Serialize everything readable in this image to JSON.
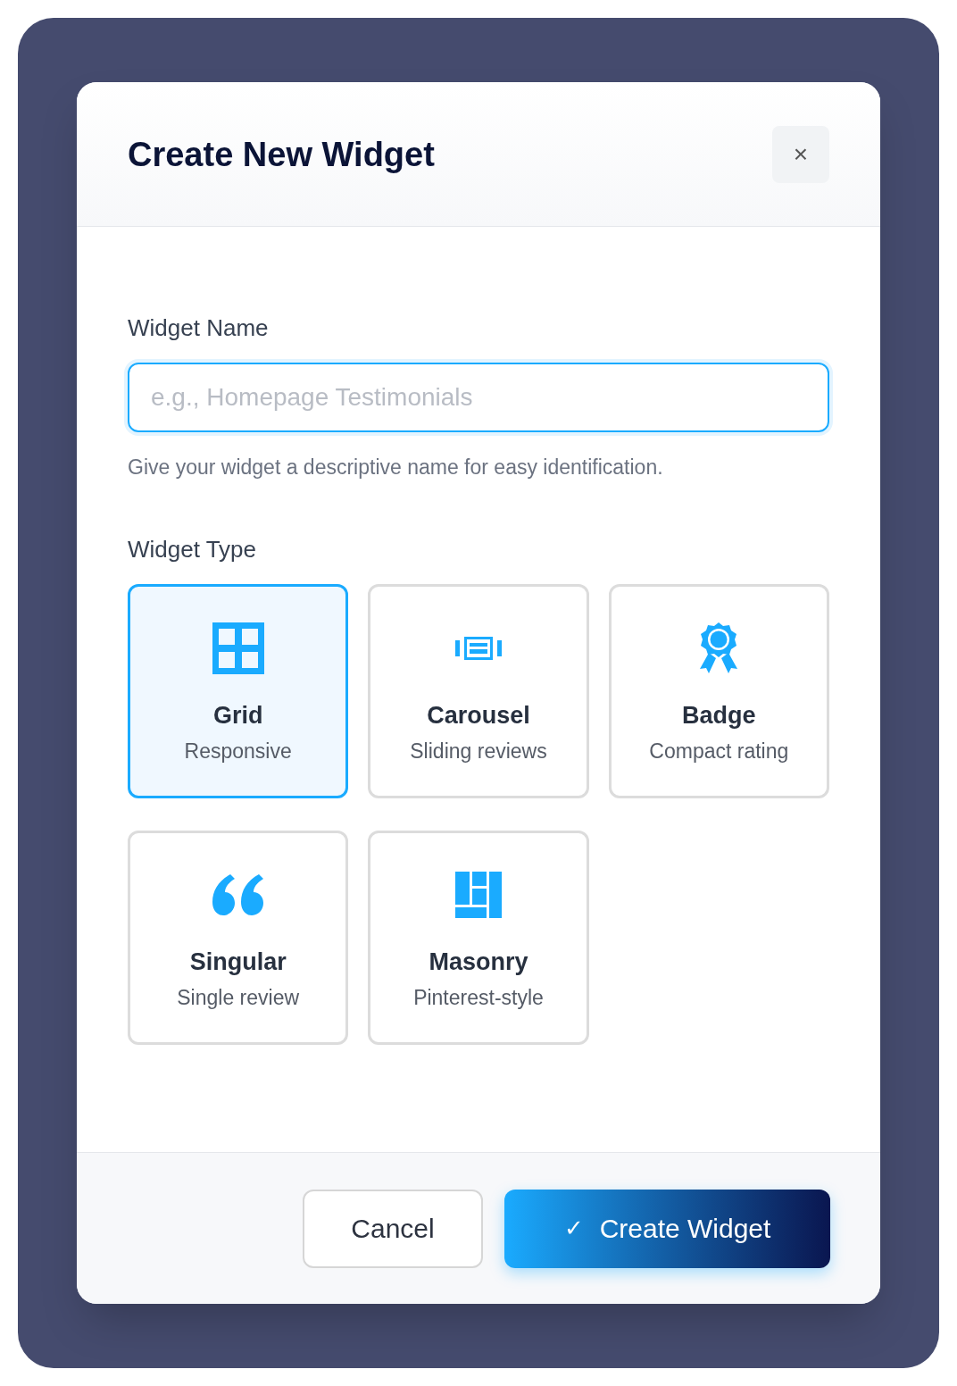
{
  "dialog": {
    "title": "Create New Widget",
    "close": "×"
  },
  "name_field": {
    "label": "Widget Name",
    "placeholder": "e.g., Homepage Testimonials",
    "hint": "Give your widget a descriptive name for easy identification."
  },
  "type_section": {
    "label": "Widget Type",
    "options": [
      {
        "kind": "grid",
        "title": "Grid",
        "subtitle": "Responsive",
        "selected": true
      },
      {
        "kind": "carousel",
        "title": "Carousel",
        "subtitle": "Sliding reviews",
        "selected": false
      },
      {
        "kind": "badge",
        "title": "Badge",
        "subtitle": "Compact rating",
        "selected": false
      },
      {
        "kind": "singular",
        "title": "Singular",
        "subtitle": "Single review",
        "selected": false
      },
      {
        "kind": "masonry",
        "title": "Masonry",
        "subtitle": "Pinterest-style",
        "selected": false
      }
    ]
  },
  "footer": {
    "cancel": "Cancel",
    "submit": "Create Widget",
    "submit_icon": "✓"
  }
}
